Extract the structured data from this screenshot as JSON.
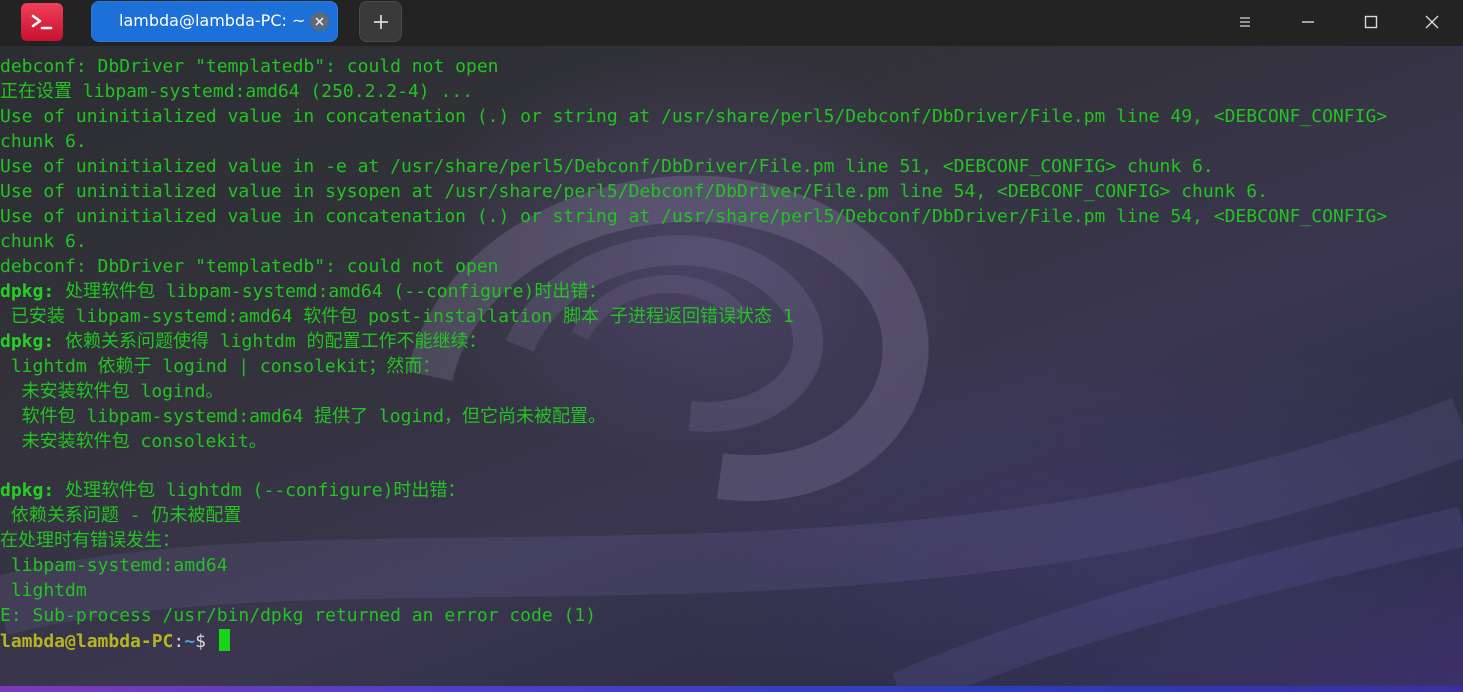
{
  "titlebar": {
    "tab_title": "lambda@lambda-PC: ~",
    "app_icon": "terminal-icon",
    "new_tab_icon": "plus-icon",
    "menu_icon": "menu-icon",
    "minimize_icon": "minimize-icon",
    "maximize_icon": "maximize-icon",
    "close_icon": "close-icon"
  },
  "terminal": {
    "lines": [
      "debconf: DbDriver \"templatedb\": could not open",
      "正在设置 libpam-systemd:amd64 (250.2.2-4) ...",
      "Use of uninitialized value in concatenation (.) or string at /usr/share/perl5/Debconf/DbDriver/File.pm line 49, <DEBCONF_CONFIG>",
      "chunk 6.",
      "Use of uninitialized value in -e at /usr/share/perl5/Debconf/DbDriver/File.pm line 51, <DEBCONF_CONFIG> chunk 6.",
      "Use of uninitialized value in sysopen at /usr/share/perl5/Debconf/DbDriver/File.pm line 54, <DEBCONF_CONFIG> chunk 6.",
      "Use of uninitialized value in concatenation (.) or string at /usr/share/perl5/Debconf/DbDriver/File.pm line 54, <DEBCONF_CONFIG>",
      "chunk 6.",
      "debconf: DbDriver \"templatedb\": could not open"
    ],
    "dpkg_label": "dpkg:",
    "dpkg_line_1": " 处理软件包 libpam-systemd:amd64 (--configure)时出错：",
    "line_installed": " 已安装 libpam-systemd:amd64 软件包 post-installation 脚本 子进程返回错误状态 1",
    "dpkg_line_2": " 依赖关系问题使得 lightdm 的配置工作不能继续：",
    "dep_lines": [
      " lightdm 依赖于 logind | consolekit；然而：",
      "  未安装软件包 logind。",
      "  软件包 libpam-systemd:amd64 提供了 logind，但它尚未被配置。",
      "  未安装软件包 consolekit。",
      ""
    ],
    "dpkg_line_3": " 处理软件包 lightdm (--configure)时出错：",
    "tail_lines": [
      " 依赖关系问题 - 仍未被配置",
      "在处理时有错误发生：",
      " libpam-systemd:amd64",
      " lightdm",
      "E: Sub-process /usr/bin/dpkg returned an error code (1)"
    ],
    "prompt": {
      "user_host": "lambda@lambda-PC",
      "colon": ":",
      "path": "~",
      "symbol": "$ "
    }
  },
  "colors": {
    "terminal_text": "#22c322",
    "tab_active": "#1c70d8",
    "titlebar_bg": "#232323",
    "prompt_user": "#b5b51f",
    "prompt_path": "#4f9ce0"
  }
}
